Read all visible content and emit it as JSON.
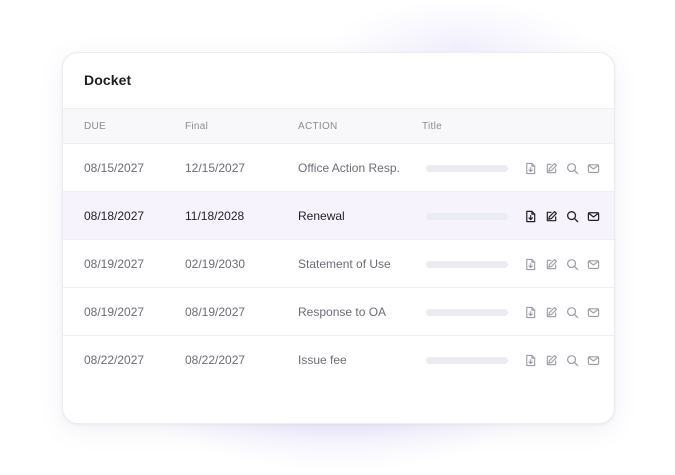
{
  "docket": {
    "title": "Docket",
    "columns": {
      "due": "DUE",
      "final": "Final",
      "action": "ACTION",
      "title": "Title"
    },
    "rows": [
      {
        "due": "08/15/2027",
        "final": "12/15/2027",
        "action": "Office Action Resp.",
        "highlighted": false
      },
      {
        "due": "08/18/2027",
        "final": "11/18/2028",
        "action": "Renewal",
        "highlighted": true
      },
      {
        "due": "08/19/2027",
        "final": "02/19/2030",
        "action": "Statement of Use",
        "highlighted": false
      },
      {
        "due": "08/19/2027",
        "final": "08/19/2027",
        "action": "Response to OA",
        "highlighted": false
      },
      {
        "due": "08/22/2027",
        "final": "08/22/2027",
        "action": "Issue fee",
        "highlighted": false
      }
    ],
    "row_icons": [
      "download-file-icon",
      "edit-icon",
      "search-icon",
      "mail-icon"
    ]
  },
  "colors": {
    "highlight_row": "#f6f3fd",
    "text_primary": "#1f1f26",
    "text_muted": "#6c6c76",
    "placeholder_bar": "#ebebf2"
  }
}
